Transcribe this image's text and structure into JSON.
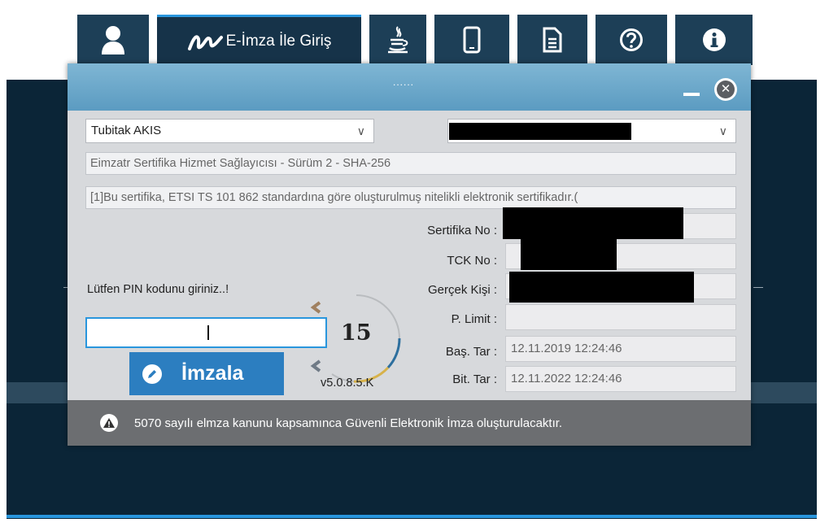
{
  "tabs": {
    "active_label": "E-İmza İle Giriş"
  },
  "dialog": {
    "grip": "......",
    "provider_select": "Tubitak AKIS",
    "cert_select_caret": "∨",
    "provider_caret": "∨",
    "provider_info": "Eimzatr Sertifika Hizmet Sağlayıcısı - Sürüm 2 - SHA-256",
    "cert_description": "[1]Bu sertifika, ETSI TS 101 862 standardına göre oluşturulmuş nitelikli elektronik sertifikadır.(",
    "fields": {
      "serial_label": "Sertifika No :",
      "tck_label": "TCK No :",
      "person_label": "Gerçek Kişi :",
      "limit_label": "P. Limit :",
      "start_label": "Baş. Tar :",
      "start_value": "12.11.2019 12:24:46",
      "end_label": "Bit. Tar :",
      "end_value": "12.11.2022 12:24:46"
    },
    "pin_prompt": "Lütfen PIN kodunu giriniz..!",
    "pin_value": "",
    "sign_button": "İmzala",
    "countdown": "15",
    "version": "v5.0.8.5.K",
    "footer_notice": "5070 sayılı elmza kanunu kapsamınca Güvenli Elektronik İmza oluşturulacaktır."
  },
  "colors": {
    "accent": "#2996dd",
    "title_bar": "#6ea9cc",
    "background": "#0b2537",
    "footer": "#6c6e71"
  },
  "icons": [
    "user-icon",
    "eimza-logo-icon",
    "java-icon",
    "mobile-icon",
    "document-icon",
    "help-icon",
    "info-icon",
    "pen-icon",
    "warning-icon",
    "close-icon"
  ]
}
